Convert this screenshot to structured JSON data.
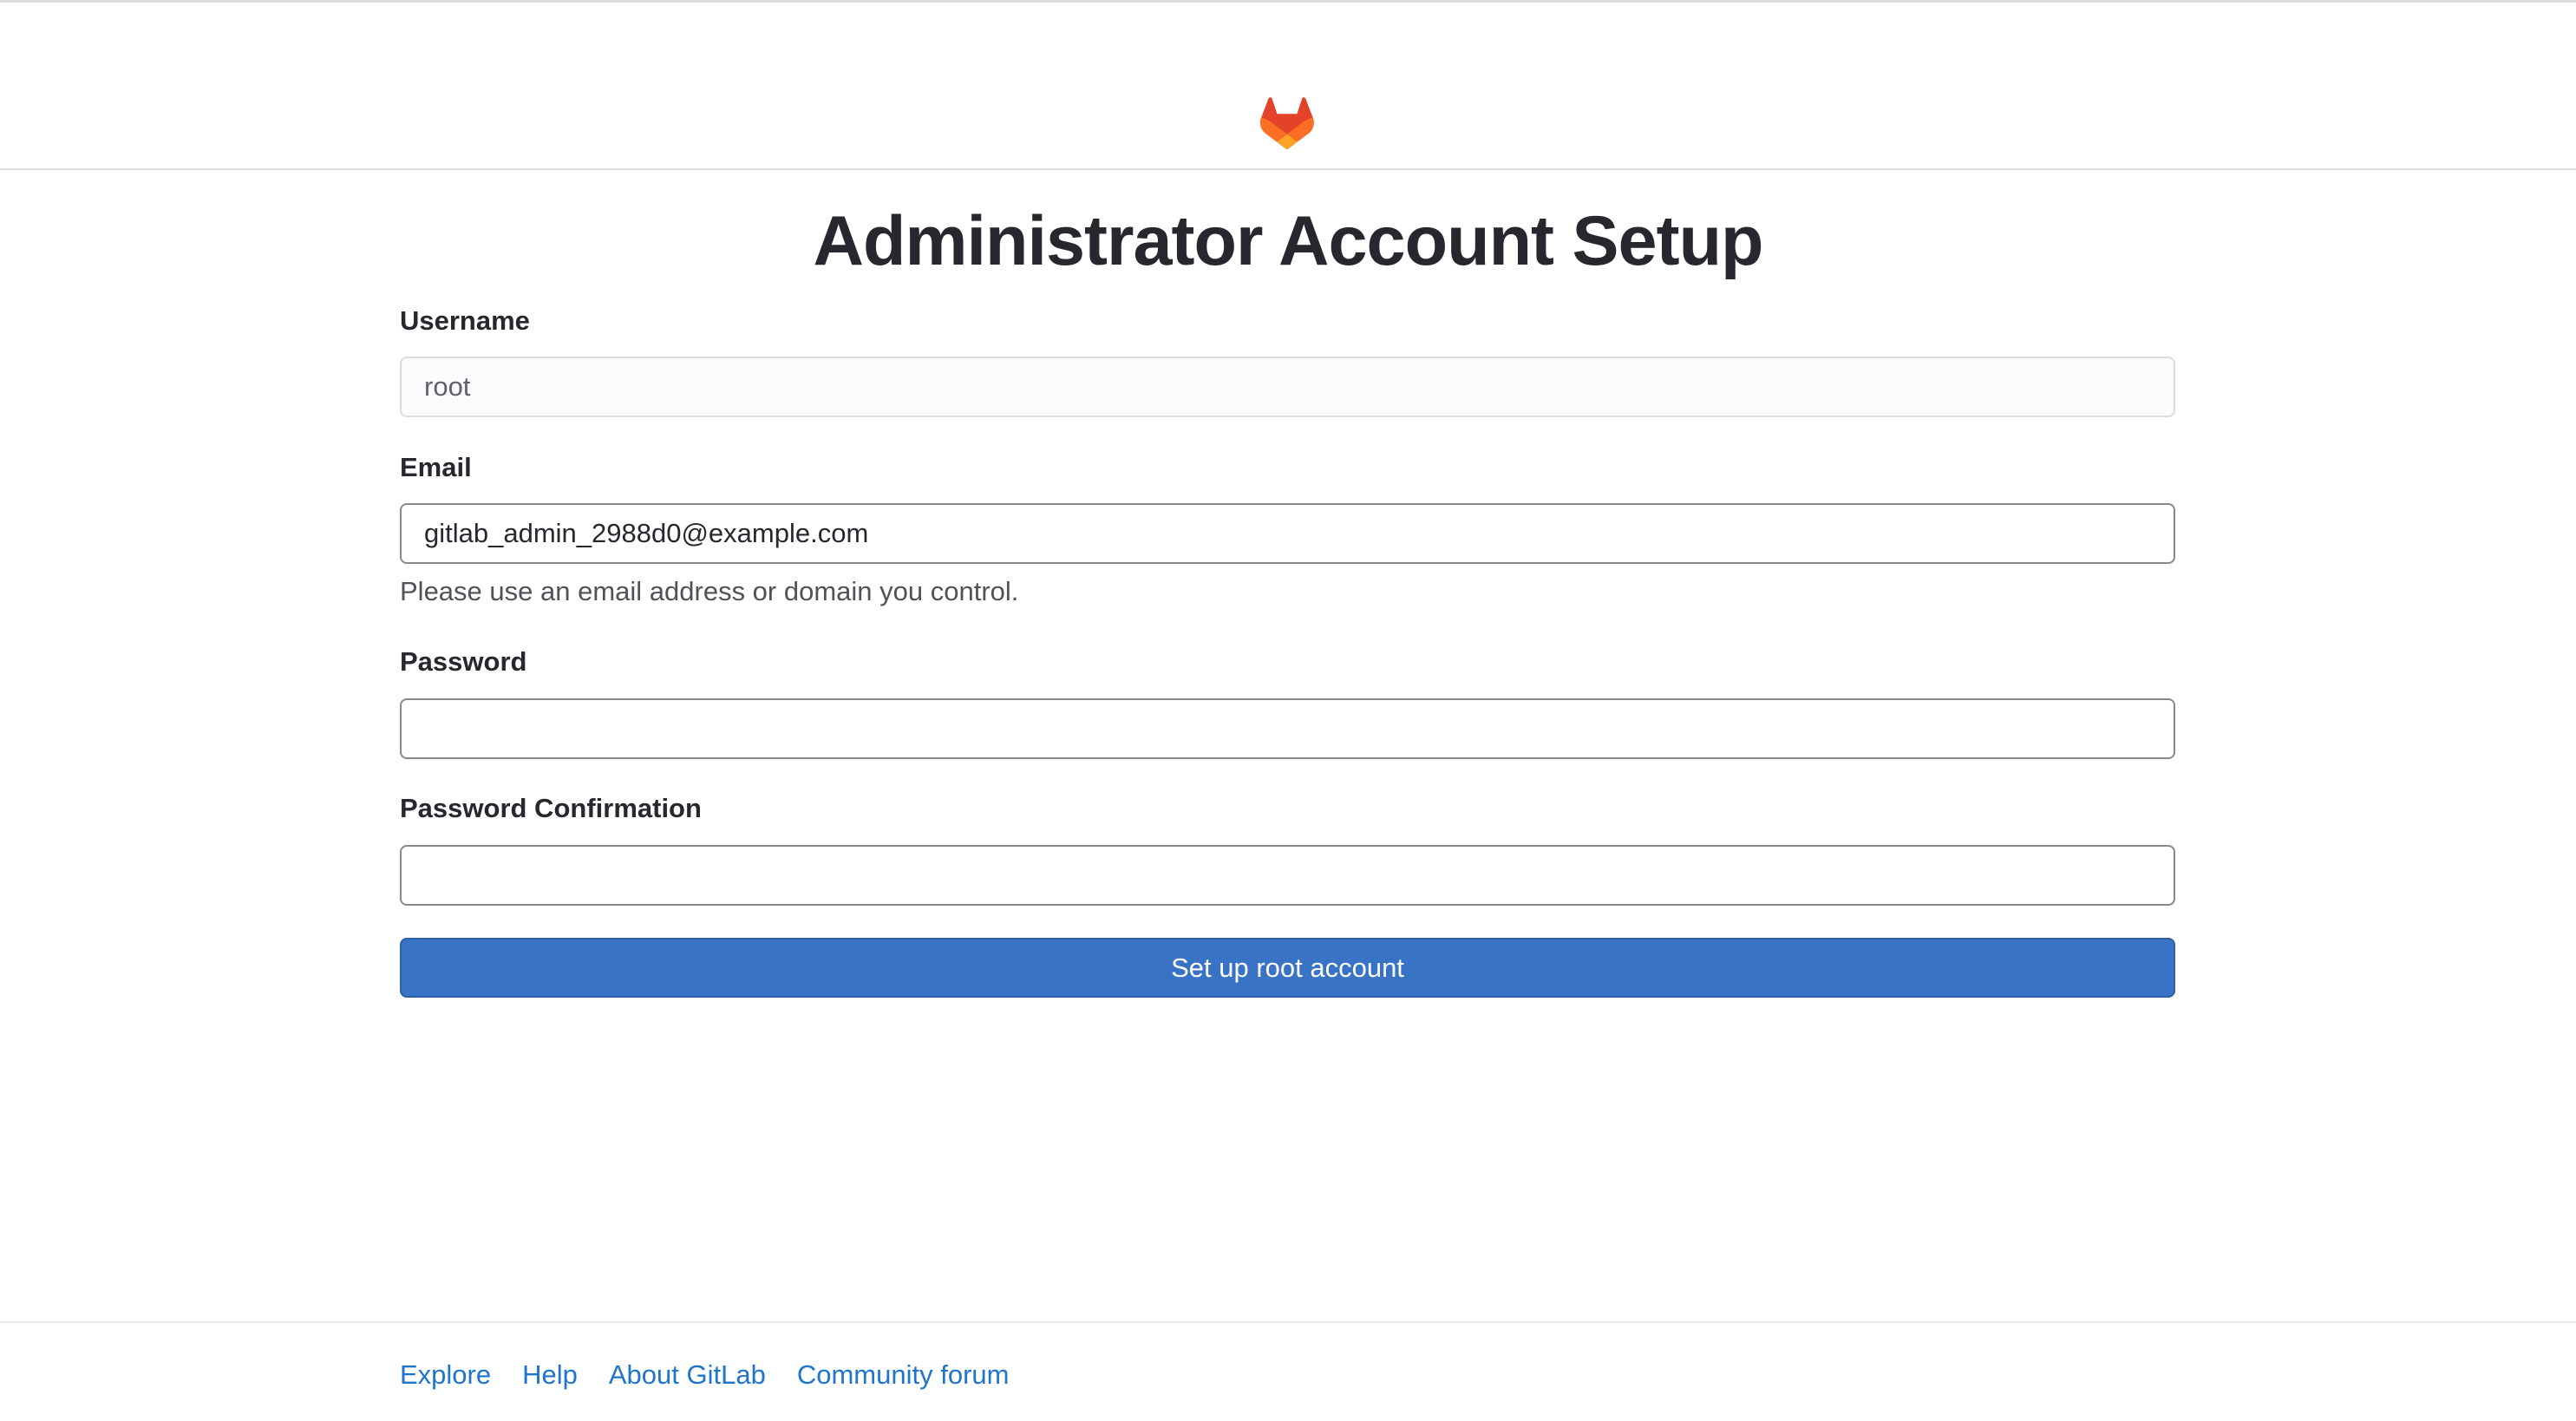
{
  "header": {
    "logo_icon": "gitlab-tanuki-icon",
    "logo_colors": [
      "#e24329",
      "#fc6d26",
      "#fca326"
    ]
  },
  "page": {
    "title": "Administrator Account Setup"
  },
  "form": {
    "username": {
      "label": "Username",
      "value": "root"
    },
    "email": {
      "label": "Email",
      "value": "gitlab_admin_2988d0@example.com",
      "help": "Please use an email address or domain you control."
    },
    "password": {
      "label": "Password",
      "value": ""
    },
    "password_confirmation": {
      "label": "Password Confirmation",
      "value": ""
    },
    "submit_label": "Set up root account",
    "accent_color": "#3873c6"
  },
  "footer": {
    "links": [
      "Explore",
      "Help",
      "About GitLab",
      "Community forum"
    ],
    "link_color": "#1f75cb"
  }
}
